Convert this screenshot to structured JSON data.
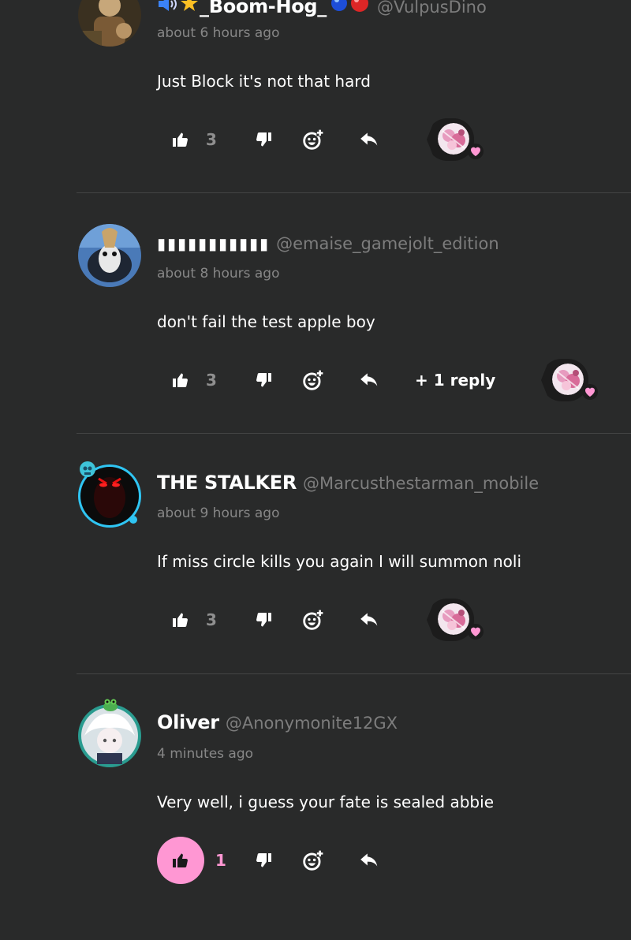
{
  "colors": {
    "background": "#292a2a",
    "divider": "#444545",
    "muted_text": "#7d7d7d",
    "accent_pink": "#ff97d3",
    "online_ring": "#2fc5f3",
    "teal_ring": "#2a9c90"
  },
  "comments": [
    {
      "display_name": "_Boom-Hog_",
      "username": "@VulpusDino",
      "time": "about 6 hours ago",
      "text": "Just Block it's not that hard",
      "like_count": "3",
      "liked": false,
      "reply_label": "",
      "has_reaction": true
    },
    {
      "display_name": "▮▮▮▮▮▮▮▮▮▮▮",
      "username": "@emaise_gamejolt_edition",
      "time": "about 8 hours ago",
      "text": "don't fail the test apple boy",
      "like_count": "3",
      "liked": false,
      "reply_label": "+ 1 reply",
      "has_reaction": true
    },
    {
      "display_name": "THE STALKER",
      "username": "@Marcusthestarman_mobile",
      "time": "about 9 hours ago",
      "text": "If miss circle kills you again I will summon noli",
      "like_count": "3",
      "liked": false,
      "reply_label": "",
      "has_reaction": true
    },
    {
      "display_name": "Oliver",
      "username": "@Anonymonite12GX",
      "time": "4 minutes ago",
      "text": "Very well, i guess your fate is sealed abbie",
      "like_count": "1",
      "liked": true,
      "reply_label": "",
      "has_reaction": false
    }
  ],
  "icons": {
    "like": "thumbs-up-icon",
    "dislike": "thumbs-down-icon",
    "react": "add-reaction-icon",
    "reply": "reply-arrow-icon",
    "heart": "heart-icon",
    "emoji_sequence": [
      "speaker-icon",
      "star-icon",
      "blue-orb-icon",
      "red-orb-icon"
    ]
  }
}
